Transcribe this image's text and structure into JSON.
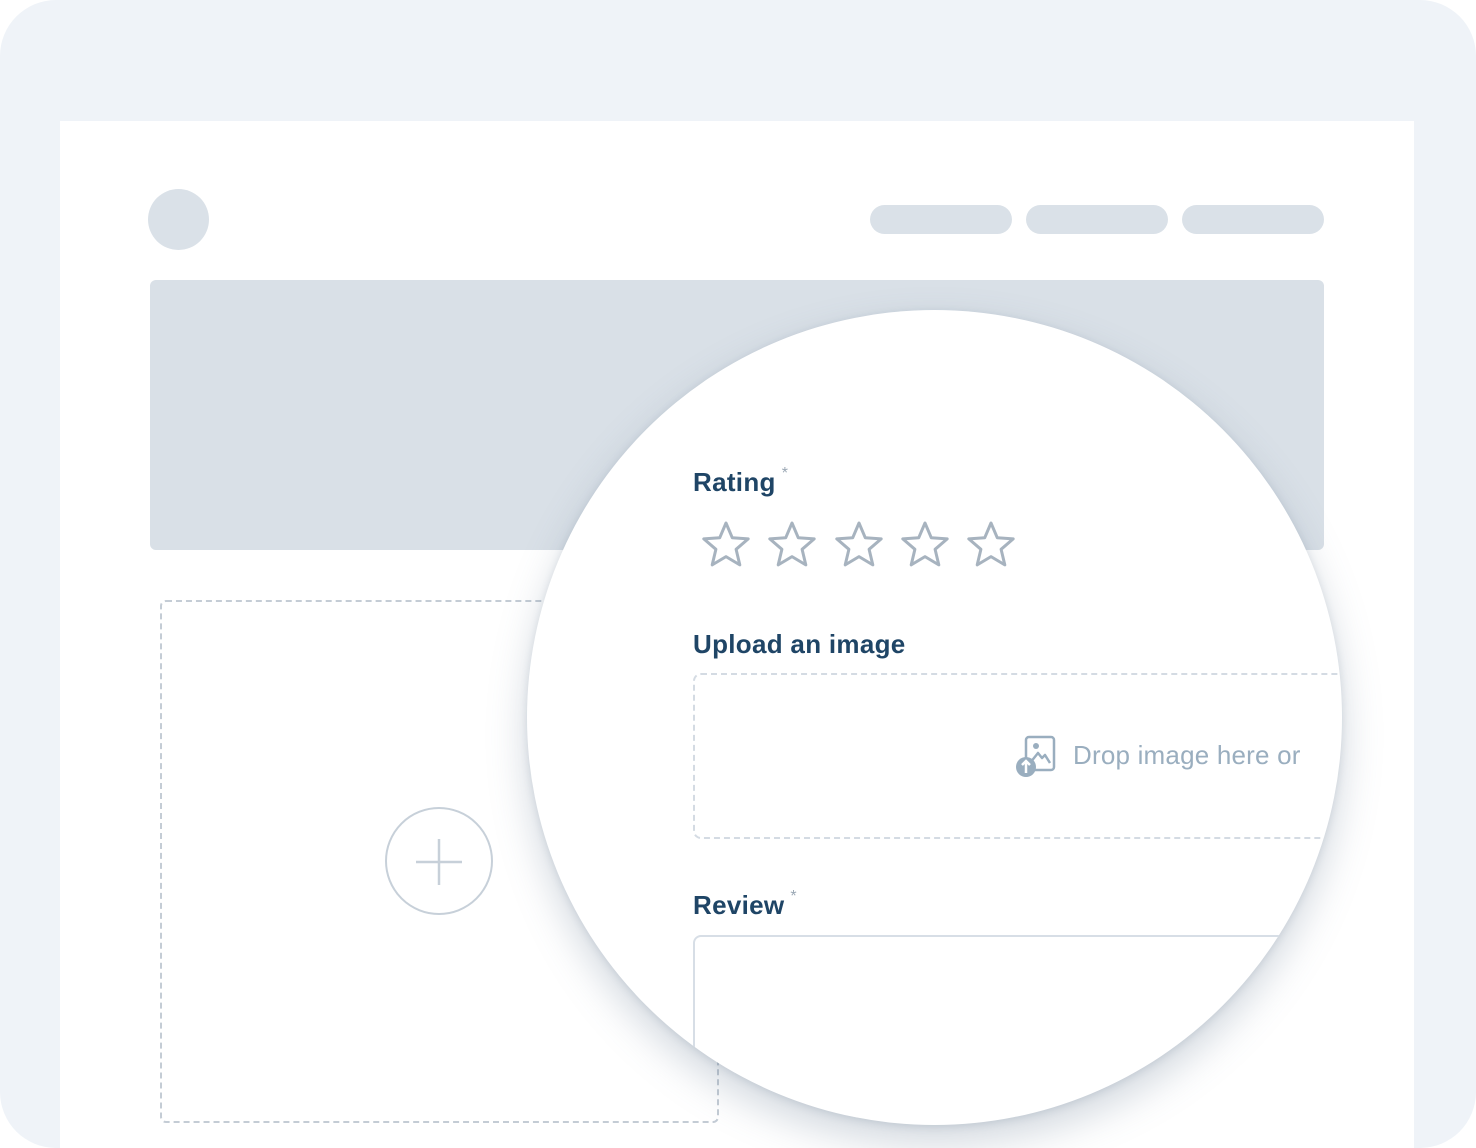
{
  "form": {
    "rating_label": "Rating",
    "required_mark": "*",
    "rating_value": 0,
    "rating_max": 5,
    "upload_label": "Upload an image",
    "drop_text": "Drop image here or",
    "review_label": "Review",
    "review_value": ""
  },
  "icons": {
    "star": "star-outline-icon",
    "upload": "image-upload-icon",
    "plus": "plus-icon"
  },
  "colors": {
    "label": "#1f4566",
    "star_outline": "#a7b3bf",
    "placeholder_block": "#dae1e8",
    "frame_bg": "#eff3f8"
  }
}
